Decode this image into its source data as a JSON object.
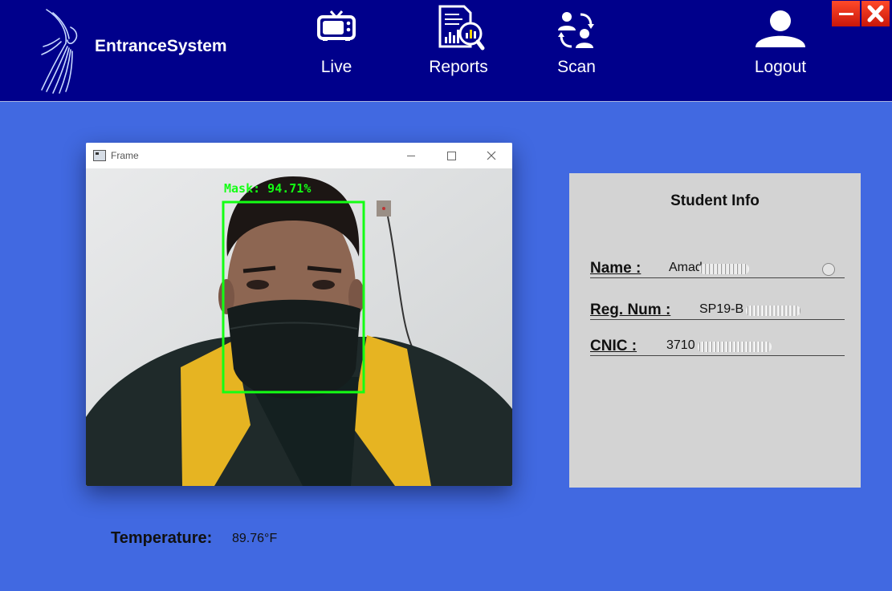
{
  "app": {
    "title": "EntranceSystem"
  },
  "nav": {
    "live": {
      "label": "Live",
      "icon": "tv-icon"
    },
    "reports": {
      "label": "Reports",
      "icon": "report-chart-icon"
    },
    "scan": {
      "label": "Scan",
      "icon": "users-switch-icon"
    },
    "logout": {
      "label": "Logout",
      "icon": "user-icon"
    }
  },
  "window_controls": {
    "minimize": "minimize-icon",
    "close": "close-icon"
  },
  "camera_window": {
    "title": "Frame",
    "detection": {
      "label": "Mask: 94.71%",
      "box_color": "#14ff14"
    }
  },
  "student_info": {
    "heading": "Student Info",
    "name": {
      "label": "Name :",
      "value": "Amad"
    },
    "reg_num": {
      "label": "Reg. Num :",
      "value": "SP19-B"
    },
    "cnic": {
      "label": "CNIC :",
      "value": "3710"
    }
  },
  "temperature": {
    "label": "Temperature:",
    "value": "89.76°F"
  },
  "colors": {
    "background": "#4169e1",
    "topbar": "#00008b",
    "panel": "#d3d3d3",
    "window_button": "#e5260f"
  }
}
